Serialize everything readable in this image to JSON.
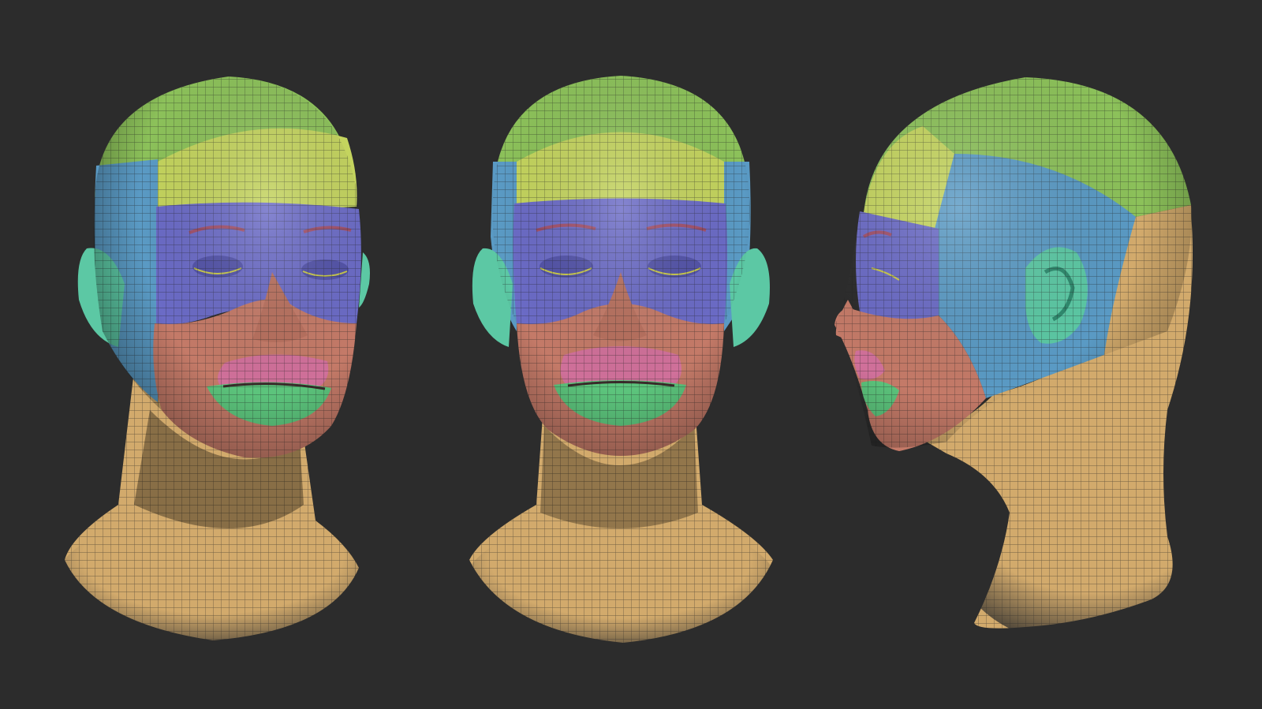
{
  "scene": {
    "background": "#2c2c2c",
    "wire_color": "#1e1e1e",
    "views": [
      "front-three-quarter",
      "front",
      "side-profile"
    ],
    "polygroup_colors": {
      "crown": "#8cc15a",
      "forehead": "#c4d45e",
      "temple": "#5a9ac4",
      "eyes": "#6b6bc6",
      "cheeks": "#c47a68",
      "upper-lip": "#d0709a",
      "lower-lip": "#5cc47c",
      "ear": "#5cc8a4",
      "neck": "#d2aa6c"
    }
  }
}
